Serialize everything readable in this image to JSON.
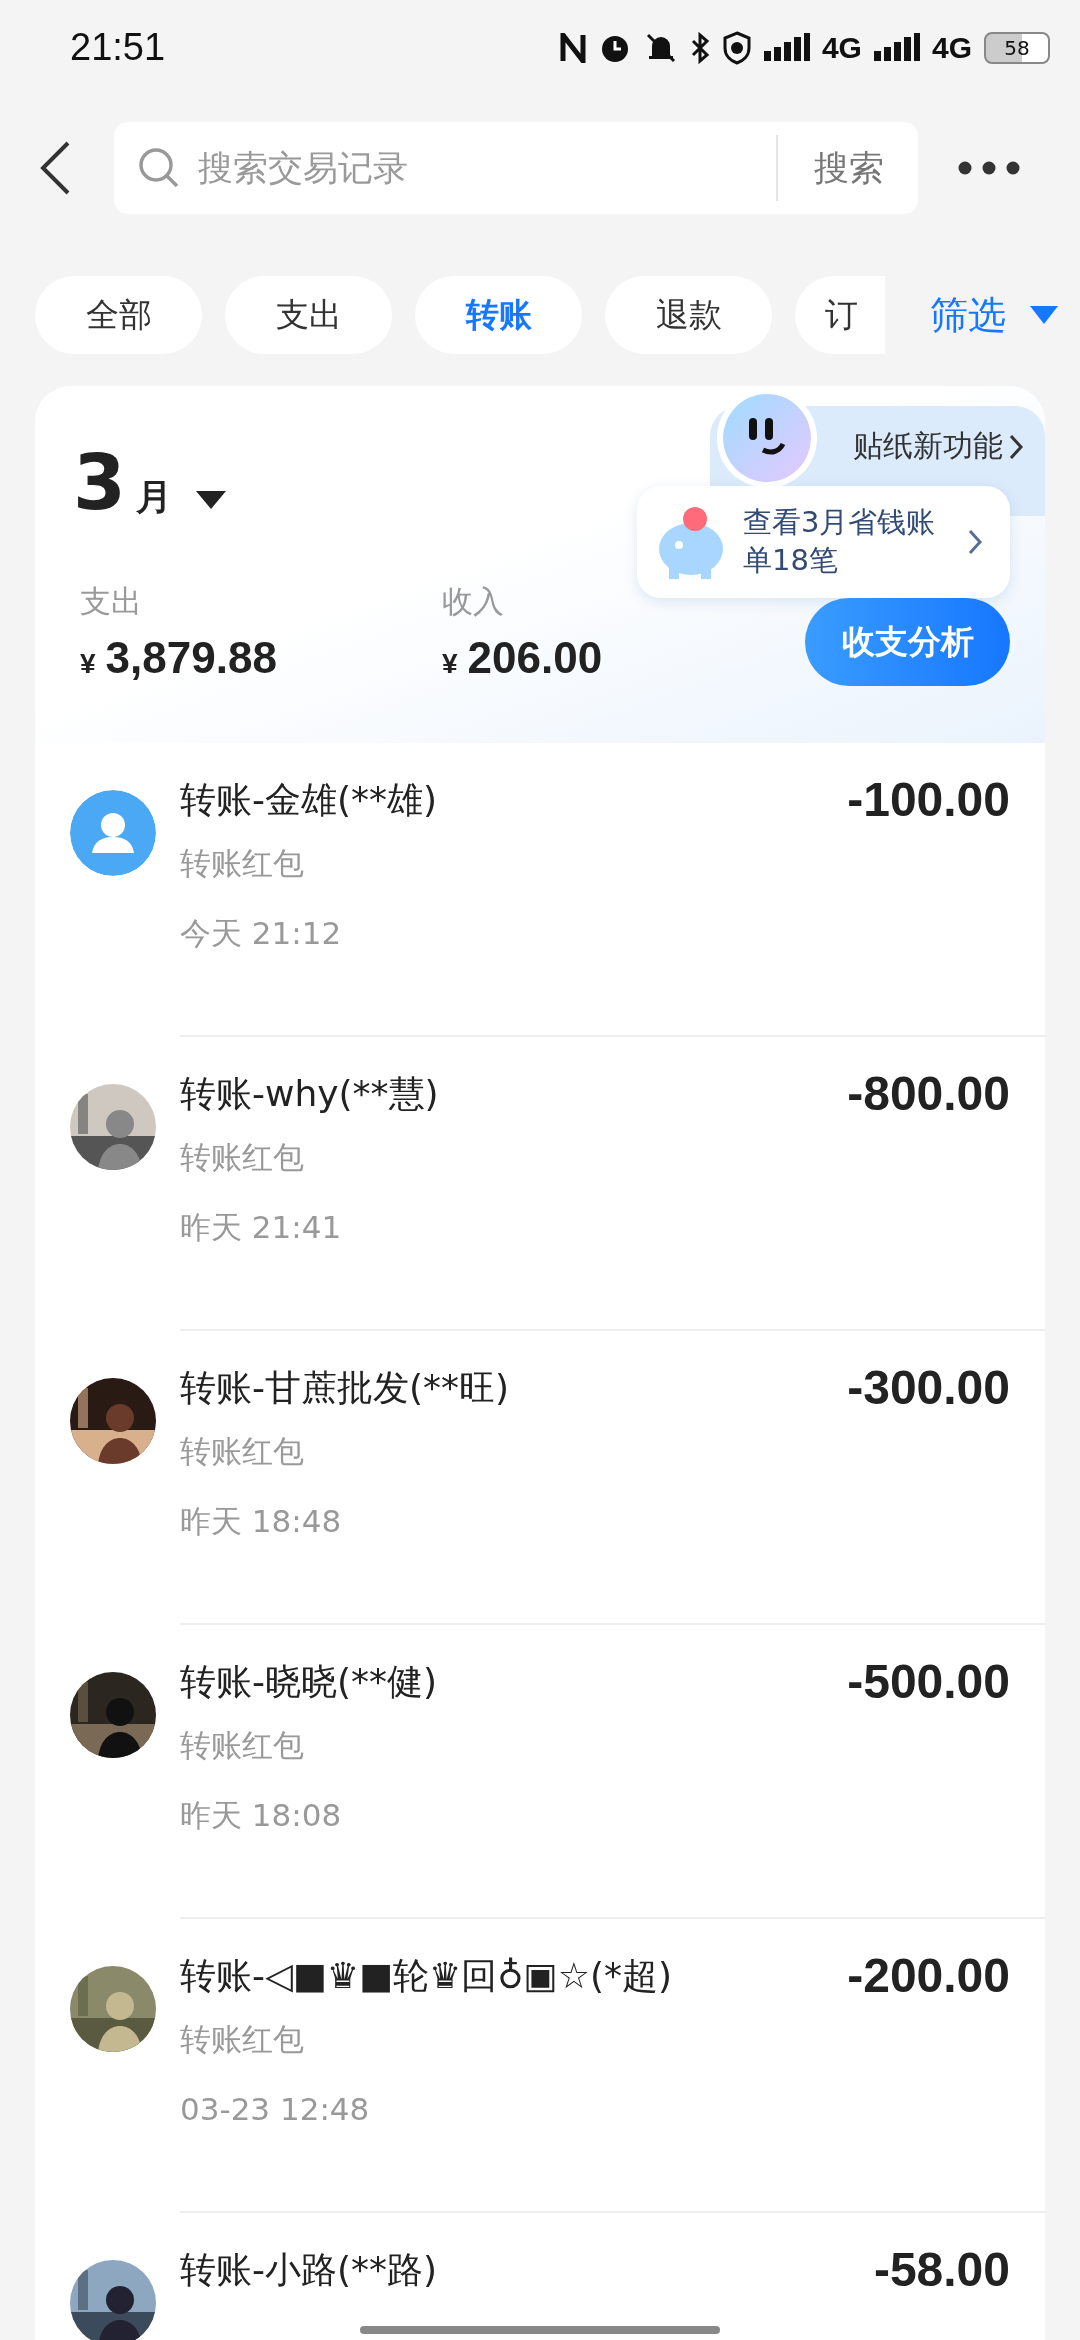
{
  "status_bar": {
    "time": "21:51",
    "network_1": "4G",
    "network_2": "4G",
    "battery": "58"
  },
  "search": {
    "placeholder": "搜索交易记录",
    "button": "搜索"
  },
  "tabs": [
    {
      "label": "全部",
      "selected": false
    },
    {
      "label": "支出",
      "selected": false
    },
    {
      "label": "转账",
      "selected": true
    },
    {
      "label": "退款",
      "selected": false
    },
    {
      "label": "订",
      "selected": false
    }
  ],
  "filter": {
    "label": "筛选"
  },
  "summary": {
    "month": "3",
    "month_unit": "月",
    "expense_label": "支出",
    "expense_currency": "¥",
    "expense": "3,879.88",
    "income_label": "收入",
    "income_currency": "¥",
    "income": "206.00"
  },
  "sticker": {
    "label": "贴纸新功能"
  },
  "tip": {
    "text": "查看3月省钱账单18笔"
  },
  "analysis_button": "收支分析",
  "transactions": [
    {
      "title": "转账-金雄(**雄)",
      "subtitle": "转账红包",
      "time": "今天 21:12",
      "amount": "-100.00",
      "avatar": {
        "kind": "default"
      }
    },
    {
      "title": "转账-why(**慧)",
      "subtitle": "转账红包",
      "time": "昨天 21:41",
      "amount": "-800.00"
    },
    {
      "title": "转账-甘蔗批发(**旺)",
      "subtitle": "转账红包",
      "time": "昨天 18:48",
      "amount": "-300.00"
    },
    {
      "title": "转账-晓晓(**健)",
      "subtitle": "转账红包",
      "time": "昨天 18:08",
      "amount": "-500.00"
    },
    {
      "title": "转账-◁■♛■轮♛回♁▣☆(*超)",
      "subtitle": "转账红包",
      "time": "03-23 12:48",
      "amount": "-200.00"
    },
    {
      "title": "转账-小路(**路)",
      "amount": "-58.00"
    }
  ]
}
